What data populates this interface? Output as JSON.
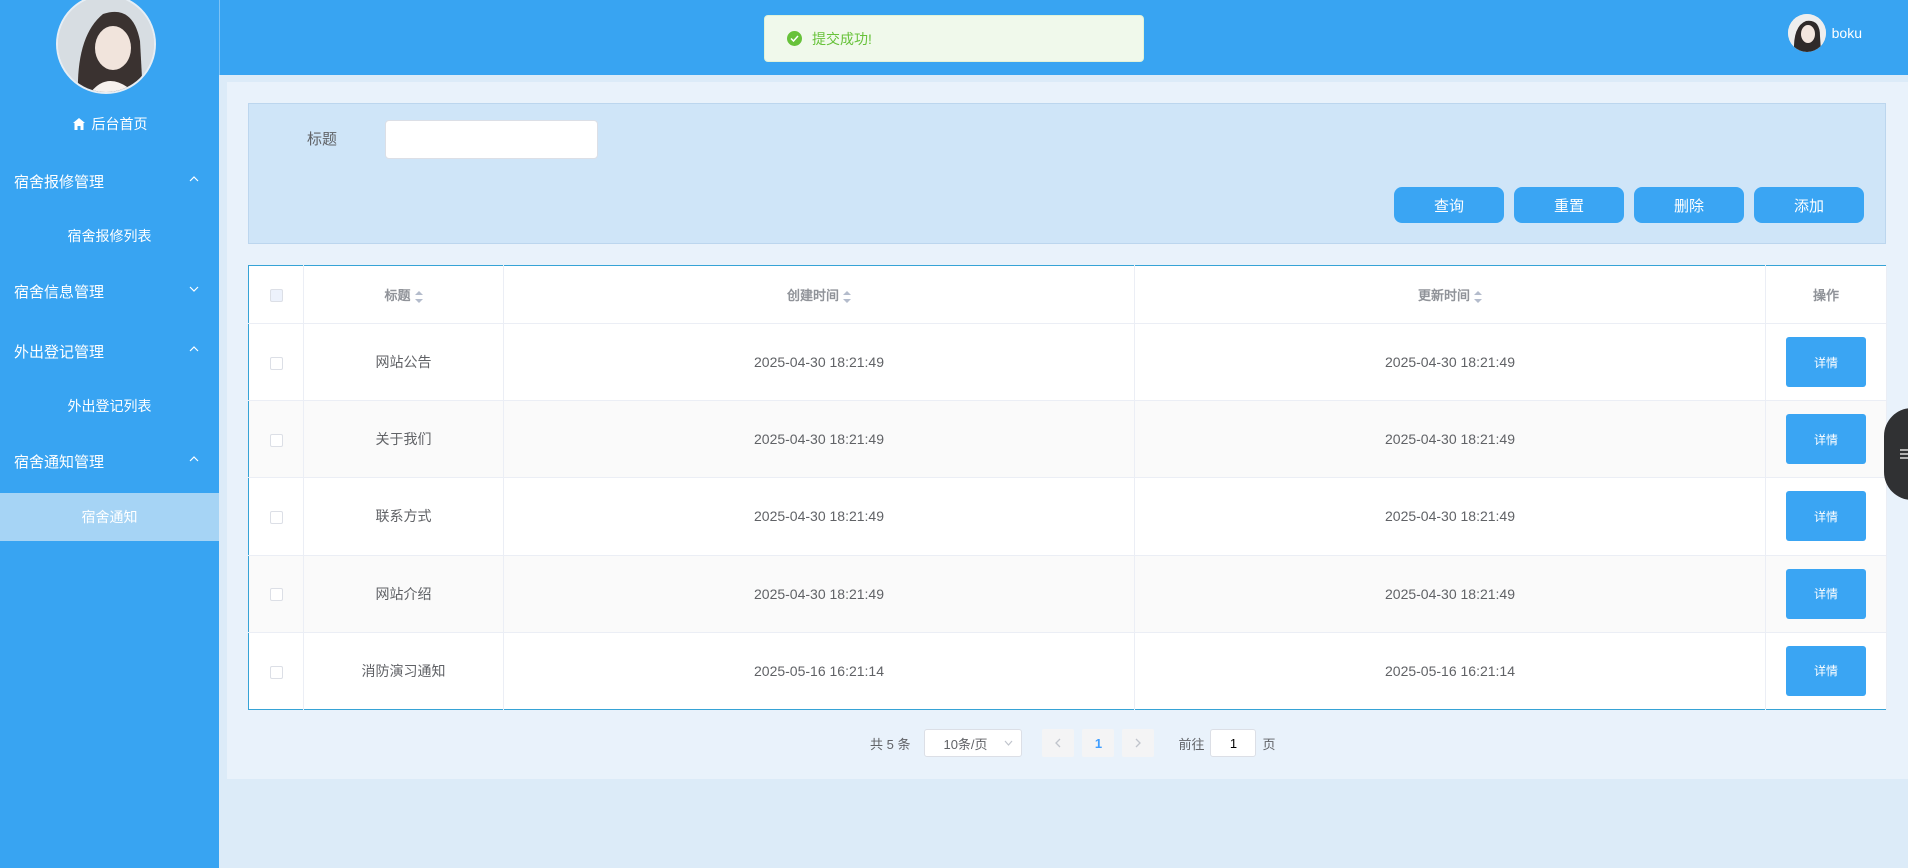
{
  "sidebar": {
    "home_label": "后台首页",
    "groups": [
      {
        "label": "宿舍报修管理",
        "expanded": true,
        "items": [
          "宿舍报修列表"
        ]
      },
      {
        "label": "宿舍信息管理",
        "expanded": false,
        "items": []
      },
      {
        "label": "外出登记管理",
        "expanded": true,
        "items": [
          "外出登记列表"
        ]
      },
      {
        "label": "宿舍通知管理",
        "expanded": true,
        "items": [
          "宿舍通知"
        ]
      }
    ],
    "active_item": "宿舍通知"
  },
  "header": {
    "username": "boku"
  },
  "toast": {
    "message": "提交成功!",
    "type": "success"
  },
  "search": {
    "title_label": "标题",
    "title_value": ""
  },
  "buttons": {
    "query": "查询",
    "reset": "重置",
    "delete": "删除",
    "add": "添加"
  },
  "table": {
    "columns": [
      "标题",
      "创建时间",
      "更新时间",
      "操作"
    ],
    "rows": [
      {
        "title": "网站公告",
        "created": "2025-04-30 18:21:49",
        "updated": "2025-04-30 18:21:49",
        "action": "详情"
      },
      {
        "title": "关于我们",
        "created": "2025-04-30 18:21:49",
        "updated": "2025-04-30 18:21:49",
        "action": "详情"
      },
      {
        "title": "联系方式",
        "created": "2025-04-30 18:21:49",
        "updated": "2025-04-30 18:21:49",
        "action": "详情"
      },
      {
        "title": "网站介绍",
        "created": "2025-04-30 18:21:49",
        "updated": "2025-04-30 18:21:49",
        "action": "详情"
      },
      {
        "title": "消防演习通知",
        "created": "2025-05-16 16:21:14",
        "updated": "2025-05-16 16:21:14",
        "action": "详情"
      }
    ]
  },
  "pagination": {
    "total_text": "共 5 条",
    "page_size": "10条/页",
    "current_page": "1",
    "goto_label": "前往",
    "goto_value": "1",
    "page_suffix": "页"
  },
  "colors": {
    "primary": "#38a4f2",
    "success": "#67c23a",
    "active_menu": "#a6d4f5"
  }
}
